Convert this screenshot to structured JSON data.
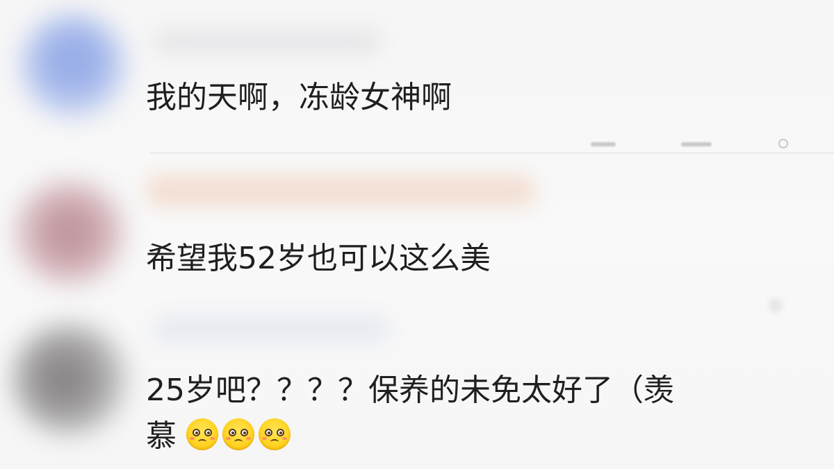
{
  "comments": [
    {
      "text": "我的天啊，冻龄女神啊"
    },
    {
      "text": "希望我52岁也可以这么美"
    },
    {
      "text_line1": "25岁吧？？？？保养的未免太好了（羡",
      "text_line2": "慕",
      "emoji": [
        "flushed-face-icon",
        "flushed-face-icon",
        "flushed-face-icon"
      ]
    }
  ],
  "colors": {
    "background": "#f7f7f7",
    "text": "#1f1f1f",
    "emoji": "#ffd21f"
  }
}
